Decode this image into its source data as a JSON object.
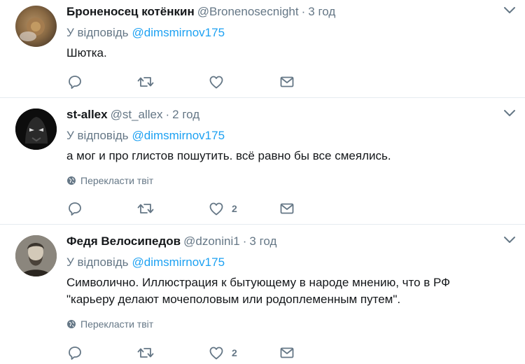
{
  "tweets": [
    {
      "name": "Броненосец котёнкин",
      "handle": "@Bronenosecnight",
      "separator": "·",
      "time": "3 год",
      "reply_prefix": "У відповідь",
      "reply_to": "@dimsmirnov175",
      "text": "Шютка.",
      "translate": "",
      "like_count": ""
    },
    {
      "name": "st-allex",
      "handle": "@st_allex",
      "separator": "·",
      "time": "2 год",
      "reply_prefix": "У відповідь",
      "reply_to": "@dimsmirnov175",
      "text": "а мог и про глистов пошутить. всё равно бы все смеялись.",
      "translate": "Перекласти твіт",
      "like_count": "2"
    },
    {
      "name": "Федя Велосипедов",
      "handle": "@dzonini1",
      "separator": "·",
      "time": "3 год",
      "reply_prefix": "У відповідь",
      "reply_to": "@dimsmirnov175",
      "text_line1": "Символично. Иллюстрация к бытующему в народе мнению, что в РФ",
      "text_line2": "\"карьеру делают мочеполовым или родоплеменным путем\".",
      "translate": "Перекласти твіт",
      "like_count": "2"
    }
  ],
  "colors": {
    "link": "#1da1f2",
    "secondary": "#657786",
    "icon": "#657786",
    "border": "#e6ecf0"
  },
  "icons": [
    "reply-icon",
    "retweet-icon",
    "like-icon",
    "message-icon",
    "globe-icon",
    "chevron-down-icon"
  ]
}
